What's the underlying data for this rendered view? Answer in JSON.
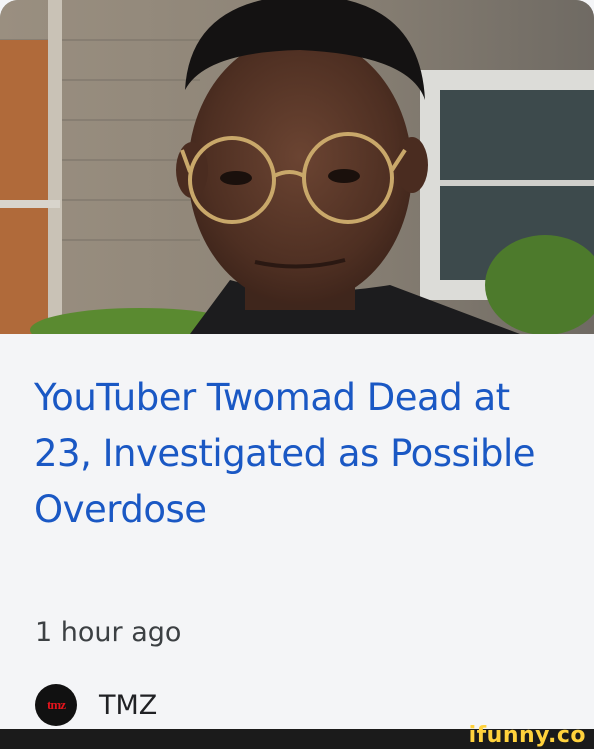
{
  "article": {
    "image_alt": "Young man wearing round gold-rimmed glasses, outdoors in front of a house",
    "headline": "YouTuber Twomad Dead at 23, Investigated as Possible Overdose",
    "time": "1 hour ago",
    "source": {
      "logo_icon": "tmz-logo-icon",
      "logo_text": "tmz",
      "name": "TMZ"
    }
  },
  "watermark": {
    "text": "ifunny.co"
  },
  "colors": {
    "headline": "#1a58c4",
    "card_background": "#f4f5f7",
    "footer_background": "#1b1b1b",
    "watermark": "#ffd23c"
  }
}
